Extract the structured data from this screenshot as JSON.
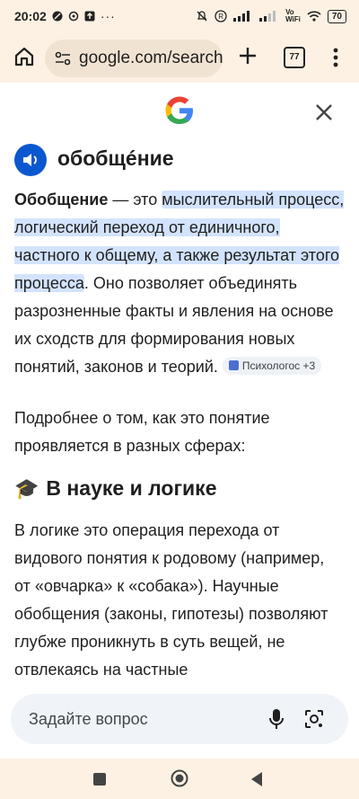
{
  "status_bar": {
    "time": "20:02",
    "network_label": "Vo\nWiFi",
    "battery": "70"
  },
  "browser": {
    "url": "google.com/search",
    "tab_count": "77"
  },
  "answer": {
    "word": "обобщéние",
    "para1_bold": "Обобщение",
    "para1_dash": " — это ",
    "para1_highlight": "мыслительный процесс, логический переход от единичного, частного к общему, а также результат этого процесса",
    "para1_rest": ". Оно позволяет объединять разрозненные факты и явления на основе их сходств для формирования новых понятий, законов и теорий. ",
    "source_chip": "Психологос +3",
    "para2": "Подробнее о том, как это понятие проявляется в разных сферах:",
    "section_emoji": "🎓",
    "section_title": "В науке и логике",
    "para3": "В логике это операция перехода от видового понятия к родовому (например, от «овчарка» к «собака»). Научные обобщения (законы, гипотезы) позволяют глубже проникнуть в суть вещей, не отвлекаясь на частные"
  },
  "ask": {
    "placeholder": "Задайте вопрос"
  },
  "colors": {
    "chrome_bg": "#fdf1e3",
    "highlight": "#d3e3fd",
    "accent": "#0b57d0"
  }
}
